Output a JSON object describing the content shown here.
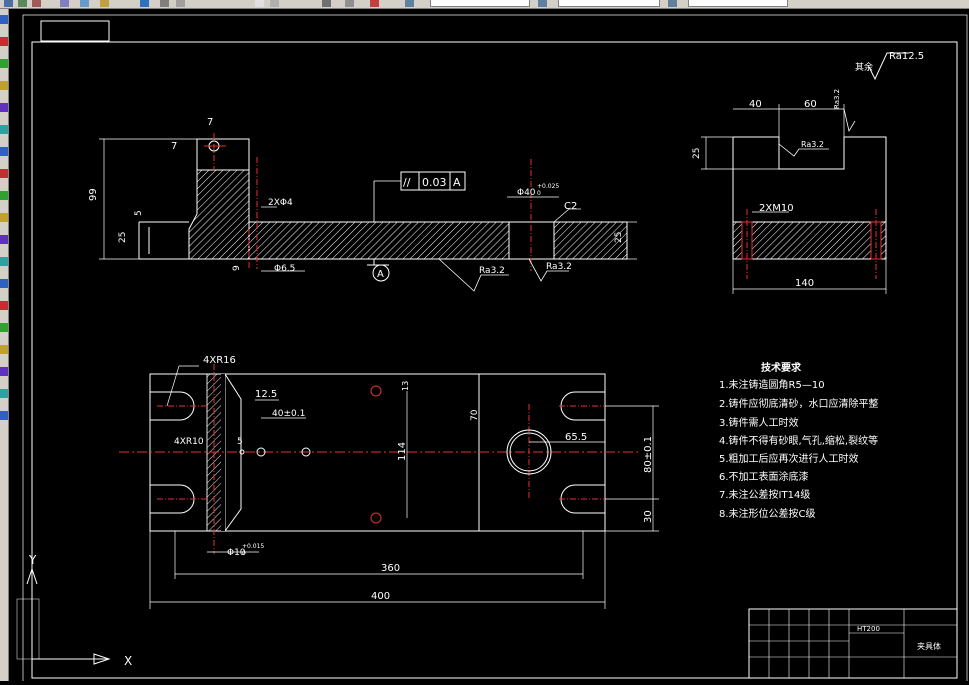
{
  "toolbar": {
    "layer_field": "",
    "style_field": "",
    "color_field": ""
  },
  "left_tools": [
    "line",
    "construction-line",
    "polyline",
    "polygon",
    "rectangle",
    "arc",
    "circle",
    "revcloud",
    "spline",
    "ellipse",
    "ellipse-arc",
    "insert-block",
    "make-block",
    "point",
    "hatch",
    "gradient",
    "region",
    "table",
    "multiline-text"
  ],
  "drawing": {
    "surface_finish_note": {
      "prefix": "其余",
      "value": "Ra12.5"
    },
    "front_view": {
      "dims": [
        "7",
        "7",
        "99",
        "5",
        "25",
        "9",
        "2XΦ4",
        "Φ6.5",
        "Φ40",
        "+0.025",
        "0",
        "C2",
        "25",
        "Ra3.2",
        "Ra3.2",
        "0.03",
        "A",
        "A"
      ],
      "feature_frame": {
        "symbol": "//",
        "tolerance": "0.03",
        "datum": "A"
      }
    },
    "side_view": {
      "dims": [
        "40",
        "60",
        "Ra3.2",
        "Ra3.2",
        "25",
        "2XM10",
        "140"
      ]
    },
    "plan_view": {
      "dims": [
        "4XR16",
        "4XR10",
        "12.5",
        "40±0.1",
        "5",
        "13",
        "114",
        "70",
        "65.5",
        "80±0.1",
        "30",
        "Φ10",
        "+0.015",
        "0",
        "360",
        "400"
      ]
    },
    "tech_requirements": {
      "title": "技术要求",
      "items": [
        "1.未注铸造圆角R5—10",
        "2.铸件应彻底清砂，水口应清除平整",
        "3.铸件需人工时效",
        "4.铸件不得有砂眼,气孔,缩松,裂纹等",
        "5.粗加工后应再次进行人工时效",
        "6.不加工表面涂底漆",
        "7.未注公差按IT14级",
        "8.未注形位公差按C级"
      ]
    },
    "title_block": {
      "material": "HT200",
      "part_name": "夹具体"
    },
    "ucs": {
      "x": "X",
      "y": "Y"
    }
  }
}
